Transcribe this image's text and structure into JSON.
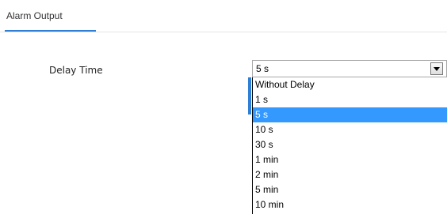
{
  "tabs": [
    {
      "label": "Alarm Output",
      "active": true
    }
  ],
  "delay_time": {
    "label": "Delay Time",
    "selected_value": "5 s",
    "options": [
      "Without Delay",
      "1 s",
      "5 s",
      "10 s",
      "30 s",
      "1 min",
      "2 min",
      "5 min",
      "10 min"
    ],
    "selected_index": 2
  },
  "colors": {
    "accent": "#2f7fd7",
    "highlight": "#3399ff"
  }
}
